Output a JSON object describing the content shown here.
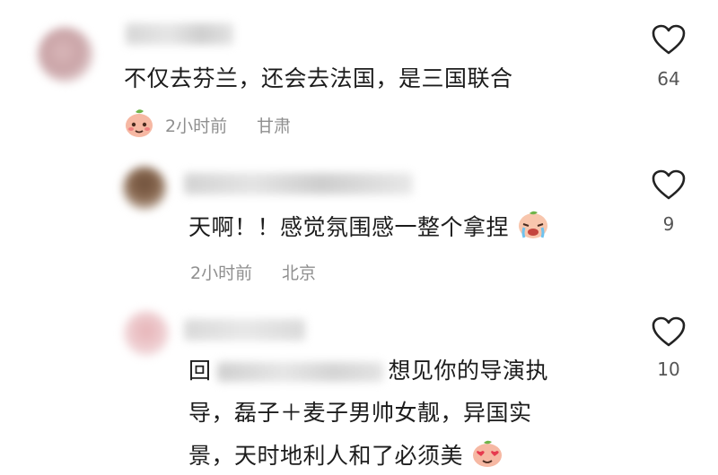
{
  "comments": [
    {
      "text": "不仅去芬兰，还会去法国，是三国联合",
      "time": "2小时前",
      "location": "甘肃",
      "likes": "64"
    },
    {
      "text": "天啊！！感觉氛围感一整个拿捏",
      "time": "2小时前",
      "location": "北京",
      "likes": "9"
    },
    {
      "reply_prefix": "回",
      "line1": "想见你的导演执",
      "line2": "导，磊子＋麦子男帅女靓，异国实",
      "line3": "景，天时地利人和了必须美",
      "likes": "10"
    }
  ],
  "icons": {
    "like": "heart-outline-icon",
    "badge": "peach-sticker-icon"
  },
  "colors": {
    "text": "#1c1c1c",
    "meta": "#8f8f8f",
    "heart": "#222222"
  }
}
